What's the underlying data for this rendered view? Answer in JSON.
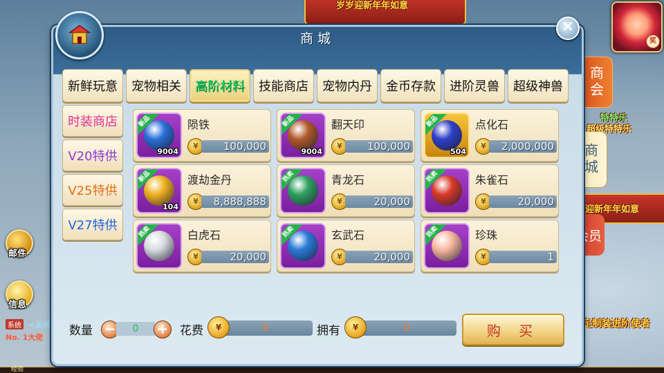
{
  "shop": {
    "title": "商城",
    "close_label": "✕",
    "categories": [
      "新鲜玩意",
      "宠物相关",
      "高阶材料",
      "技能商店",
      "宠物内丹",
      "金币存款",
      "进阶灵兽",
      "超级神兽"
    ],
    "active_category": "高阶材料",
    "side_tabs": [
      {
        "label": "时装商店",
        "color": "#e0309a"
      },
      {
        "label": "V20特供",
        "color": "#8a3ad8"
      },
      {
        "label": "V25特供",
        "color": "#e0701a"
      },
      {
        "label": "V27特供",
        "color": "#2060e0"
      }
    ],
    "items": [
      {
        "name": "陨铁",
        "badge": "新品",
        "count": "9004",
        "price": "100,000",
        "gem": "#2b6fd8",
        "frame": "purple"
      },
      {
        "name": "翻天印",
        "badge": "新品",
        "count": "9004",
        "price": "100,000",
        "gem": "#b05a2a",
        "frame": "purple"
      },
      {
        "name": "点化石",
        "badge": "新品",
        "count": "504",
        "price": "2,000,000",
        "gem": "#3040c8",
        "frame": "gold"
      },
      {
        "name": "渡劫金丹",
        "badge": "新品",
        "count": "104",
        "price": "8,888,888",
        "gem": "#f0b020",
        "frame": "purple"
      },
      {
        "name": "青龙石",
        "badge": "热卖",
        "count": "",
        "price": "20,000",
        "gem": "#2ea060",
        "frame": "purple"
      },
      {
        "name": "朱雀石",
        "badge": "热卖",
        "count": "",
        "price": "20,000",
        "gem": "#d83a2a",
        "frame": "purple"
      },
      {
        "name": "白虎石",
        "badge": "热卖",
        "count": "",
        "price": "20,000",
        "gem": "#d8dce0",
        "frame": "purple"
      },
      {
        "name": "玄武石",
        "badge": "热卖",
        "count": "",
        "price": "20,000",
        "gem": "#2a7ad8",
        "frame": "purple"
      },
      {
        "name": "珍珠",
        "badge": "热卖",
        "count": "",
        "price": "1",
        "gem": "#f8b8a0",
        "frame": "purple"
      }
    ],
    "bottom": {
      "qty_label": "数量",
      "qty_value": "0",
      "minus": "−",
      "plus": "+",
      "cost_label": "花费",
      "cost_value": "0",
      "own_label": "拥有",
      "own_value": "0",
      "buy_label": "购 买"
    }
  },
  "hud": {
    "mail_label": "邮件",
    "info_label": "信息",
    "chat_tag": "系统",
    "chat_text": "<系统",
    "rank_text": "No. 1大佬",
    "exp_label": "经验",
    "right_tabs": [
      "商会",
      "商城",
      "会员"
    ],
    "banner_top": "岁岁迎新年年如意",
    "banner_right": "迎新年年如意",
    "super_special": "超级特特乐",
    "enjoy_text": "特特乐",
    "custom_text": "定制装进阶使者",
    "vip_badge": "奖",
    "pet_tag": "宠物相关"
  }
}
